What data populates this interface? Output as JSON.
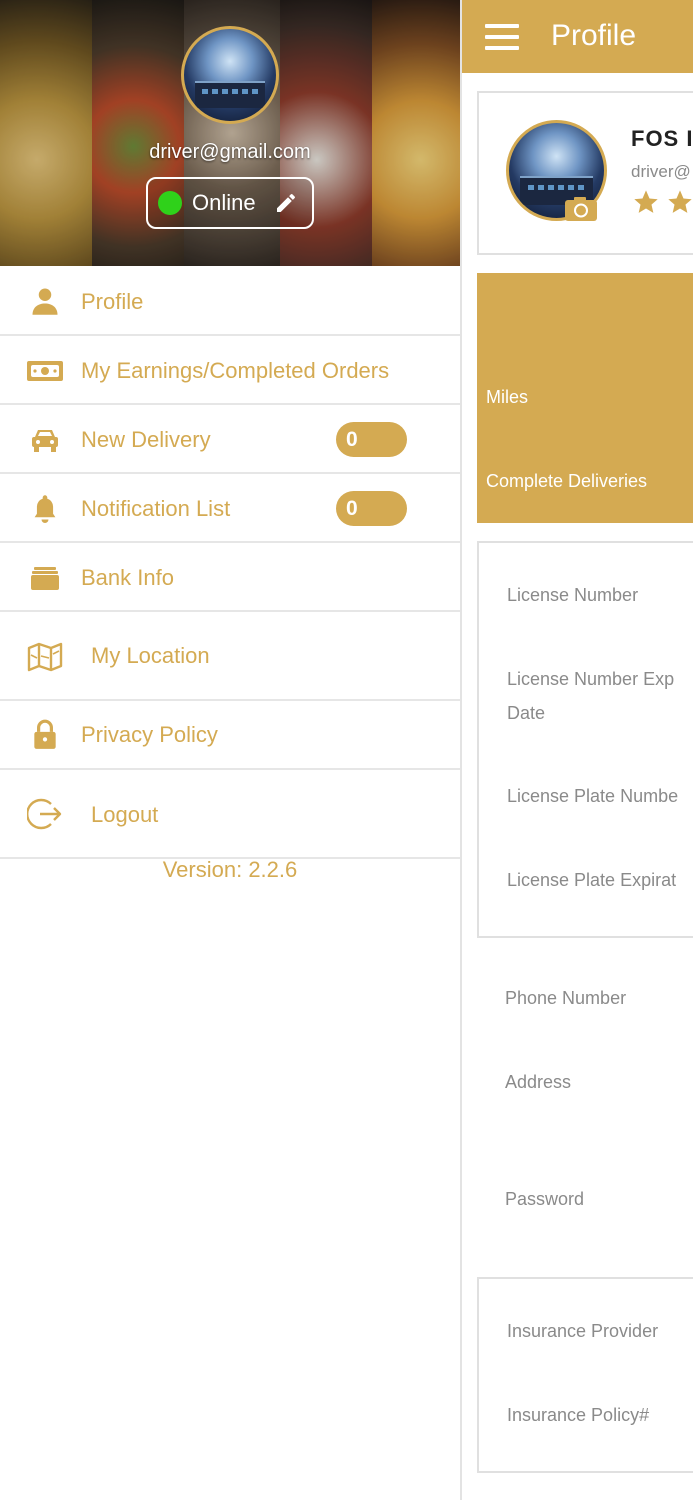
{
  "drawer": {
    "email": "driver@gmail.com",
    "status": {
      "label": "Online",
      "color": "#2fd11a"
    },
    "items": [
      {
        "label": "Profile",
        "icon": "person-icon"
      },
      {
        "label": "My Earnings/Completed Orders",
        "icon": "money-icon"
      },
      {
        "label": "New Delivery",
        "icon": "car-icon",
        "badge": "0"
      },
      {
        "label": "Notification List",
        "icon": "bell-icon",
        "badge": "0"
      },
      {
        "label": "Bank Info",
        "icon": "wallet-icon"
      },
      {
        "label": "My Location",
        "icon": "map-icon"
      },
      {
        "label": "Privacy Policy",
        "icon": "lock-icon"
      },
      {
        "label": "Logout",
        "icon": "logout-icon"
      }
    ],
    "version": "Version: 2.2.6"
  },
  "screen": {
    "title": "Profile",
    "card": {
      "name": "FOS I",
      "email": "driver@",
      "rating_stars_visible": 2
    },
    "stats": {
      "miles_label": "Miles",
      "deliveries_label": "Complete Deliveries"
    },
    "license_fields": [
      "License Number",
      "License Number Exp Date",
      "License Plate Numbe",
      "License Plate Expirat"
    ],
    "contact_fields": [
      "Phone Number",
      "Address",
      "Password"
    ],
    "insurance_fields": [
      "Insurance Provider",
      "Insurance Policy#"
    ]
  },
  "colors": {
    "accent": "#d4aa52",
    "online": "#2fd11a",
    "divider": "#e6e6e6"
  }
}
